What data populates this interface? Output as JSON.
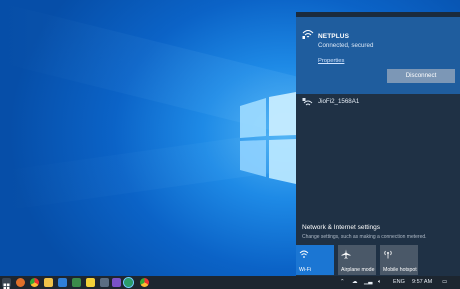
{
  "flyout": {
    "connected_network": {
      "name": "NETPLUS",
      "status": "Connected, secured",
      "properties_link": "Properties",
      "disconnect_label": "Disconnect",
      "icon": "wifi-icon"
    },
    "other_network": {
      "name": "JioFi2_1568A1",
      "icon": "wifi-secured-icon"
    },
    "settings": {
      "title": "Network & Internet settings",
      "description": "Change settings, such as making a connection metered."
    },
    "tiles": [
      {
        "label": "Wi-Fi",
        "active": true,
        "icon": "wifi-icon"
      },
      {
        "label": "Airplane mode",
        "active": false,
        "icon": "airplane-icon"
      },
      {
        "label": "Mobile hotspot",
        "active": false,
        "icon": "hotspot-icon"
      }
    ]
  },
  "taskbar": {
    "apps": [
      "search-icon",
      "firefox-icon",
      "chrome-icon",
      "folder-icon",
      "store-icon",
      "sticky-notes-icon",
      "app-icon",
      "edge-icon",
      "network-app-icon",
      "chrome-icon"
    ],
    "tray": {
      "language": "ENG",
      "time": "9:57 AM"
    }
  },
  "colors": {
    "flyout_bg": "#1f3145",
    "connected_bg": "#1f5d9e",
    "accent": "#1b76d3",
    "taskbar_bg": "#1d2630"
  }
}
